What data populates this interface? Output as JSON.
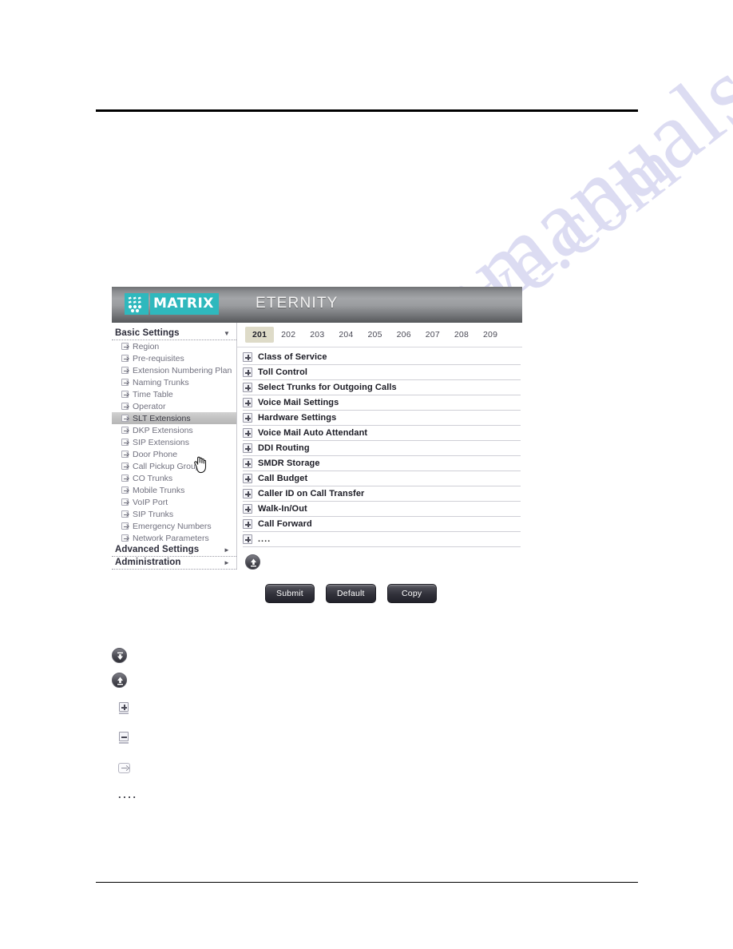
{
  "app": {
    "brand": "MATRIX",
    "product": "ETERNITY",
    "logo_icon": "matrix-dots-logo"
  },
  "sidebar": {
    "groups": [
      {
        "label": "Basic Settings",
        "expanded": true,
        "caret_icon": "chevron-down-icon",
        "items": [
          {
            "label": "Region",
            "icon": "plus-arrow-box-icon",
            "selected": false
          },
          {
            "label": "Pre-requisites",
            "icon": "plus-arrow-box-icon",
            "selected": false
          },
          {
            "label": "Extension Numbering Plan",
            "icon": "plus-arrow-box-icon",
            "selected": false
          },
          {
            "label": "Naming Trunks",
            "icon": "plus-arrow-box-icon",
            "selected": false
          },
          {
            "label": "Time Table",
            "icon": "plus-arrow-box-icon",
            "selected": false
          },
          {
            "label": "Operator",
            "icon": "plus-arrow-box-icon",
            "selected": false
          },
          {
            "label": "SLT Extensions",
            "icon": "plus-arrow-box-icon",
            "selected": true
          },
          {
            "label": "DKP Extensions",
            "icon": "plus-arrow-box-icon",
            "selected": false
          },
          {
            "label": "SIP Extensions",
            "icon": "plus-arrow-box-icon",
            "selected": false
          },
          {
            "label": "Door Phone",
            "icon": "plus-arrow-box-icon",
            "selected": false
          },
          {
            "label": "Call Pickup Group",
            "icon": "plus-arrow-box-icon",
            "selected": false
          },
          {
            "label": "CO Trunks",
            "icon": "plus-arrow-box-icon",
            "selected": false
          },
          {
            "label": "Mobile Trunks",
            "icon": "plus-arrow-box-icon",
            "selected": false
          },
          {
            "label": "VoIP Port",
            "icon": "plus-arrow-box-icon",
            "selected": false
          },
          {
            "label": "SIP Trunks",
            "icon": "plus-arrow-box-icon",
            "selected": false
          },
          {
            "label": "Emergency Numbers",
            "icon": "plus-arrow-box-icon",
            "selected": false
          },
          {
            "label": "Network Parameters",
            "icon": "plus-arrow-box-icon",
            "selected": false
          }
        ]
      },
      {
        "label": "Advanced Settings",
        "expanded": false,
        "caret_icon": "chevron-right-icon",
        "items": []
      },
      {
        "label": "Administration",
        "expanded": false,
        "caret_icon": "chevron-right-icon",
        "items": []
      }
    ],
    "cursor_icon": "hand-pointer-cursor"
  },
  "content": {
    "tabs": [
      {
        "label": "201",
        "active": true
      },
      {
        "label": "202",
        "active": false
      },
      {
        "label": "203",
        "active": false
      },
      {
        "label": "204",
        "active": false
      },
      {
        "label": "205",
        "active": false
      },
      {
        "label": "206",
        "active": false
      },
      {
        "label": "207",
        "active": false
      },
      {
        "label": "208",
        "active": false
      },
      {
        "label": "209",
        "active": false
      }
    ],
    "sections": [
      {
        "label": "Class of Service",
        "icon": "expand-plus-icon"
      },
      {
        "label": "Toll Control",
        "icon": "expand-plus-icon"
      },
      {
        "label": "Select Trunks for Outgoing Calls",
        "icon": "expand-plus-icon"
      },
      {
        "label": "Voice Mail Settings",
        "icon": "expand-plus-icon"
      },
      {
        "label": "Hardware Settings",
        "icon": "expand-plus-icon"
      },
      {
        "label": "Voice Mail Auto Attendant",
        "icon": "expand-plus-icon"
      },
      {
        "label": "DDI Routing",
        "icon": "expand-plus-icon"
      },
      {
        "label": "SMDR Storage",
        "icon": "expand-plus-icon"
      },
      {
        "label": "Call Budget",
        "icon": "expand-plus-icon"
      },
      {
        "label": "Caller ID on Call Transfer",
        "icon": "expand-plus-icon"
      },
      {
        "label": "Walk-In/Out",
        "icon": "expand-plus-icon"
      },
      {
        "label": "Call Forward",
        "icon": "expand-plus-icon"
      },
      {
        "label": "....",
        "icon": "expand-plus-icon"
      }
    ],
    "collapse_all_icon": "collapse-up-circle-icon",
    "buttons": [
      {
        "label": "Submit"
      },
      {
        "label": "Default"
      },
      {
        "label": "Copy"
      }
    ]
  },
  "legend": {
    "items": [
      {
        "icon": "expand-all-down-circle-icon"
      },
      {
        "icon": "collapse-all-up-circle-icon"
      },
      {
        "icon": "expand-plus-box-icon"
      },
      {
        "icon": "collapse-minus-box-icon"
      },
      {
        "icon": "navigate-arrow-box-icon"
      },
      {
        "icon": "more-dots-icon",
        "text": "...."
      }
    ]
  },
  "watermark": {
    "line1": "manualsarchive.com",
    "line2": "manualsarchive.com"
  },
  "colors": {
    "brand_teal": "#2fb8bd",
    "active_tab": "#dedbc8",
    "selected_nav": "#c4c4c4",
    "button_dark": "#31313a"
  }
}
